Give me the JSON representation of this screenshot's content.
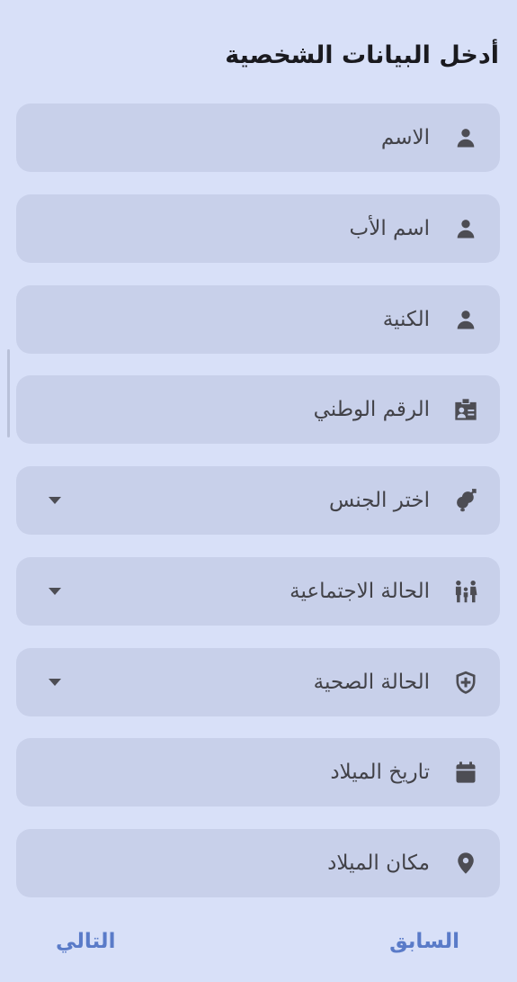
{
  "form": {
    "title": "أدخل البيانات الشخصية",
    "fields": [
      {
        "label": "الاسم",
        "icon": "person-icon"
      },
      {
        "label": "اسم الأب",
        "icon": "person-icon"
      },
      {
        "label": "الكنية",
        "icon": "person-icon"
      },
      {
        "label": "الرقم الوطني",
        "icon": "id-badge-icon"
      },
      {
        "label": "اختر الجنس",
        "icon": "gender-icon",
        "dropdown": true
      },
      {
        "label": "الحالة الاجتماعية",
        "icon": "family-icon",
        "dropdown": true
      },
      {
        "label": "الحالة الصحية",
        "icon": "shield-plus-icon",
        "dropdown": true
      },
      {
        "label": "تاريخ الميلاد",
        "icon": "calendar-icon"
      },
      {
        "label": "مكان الميلاد",
        "icon": "location-pin-icon"
      }
    ]
  },
  "nav": {
    "previous_label": "السابق",
    "next_label": "التالي"
  },
  "colors": {
    "background": "#d8e0f8",
    "field_background": "#c8d0ea",
    "accent": "#5a7bc8"
  }
}
